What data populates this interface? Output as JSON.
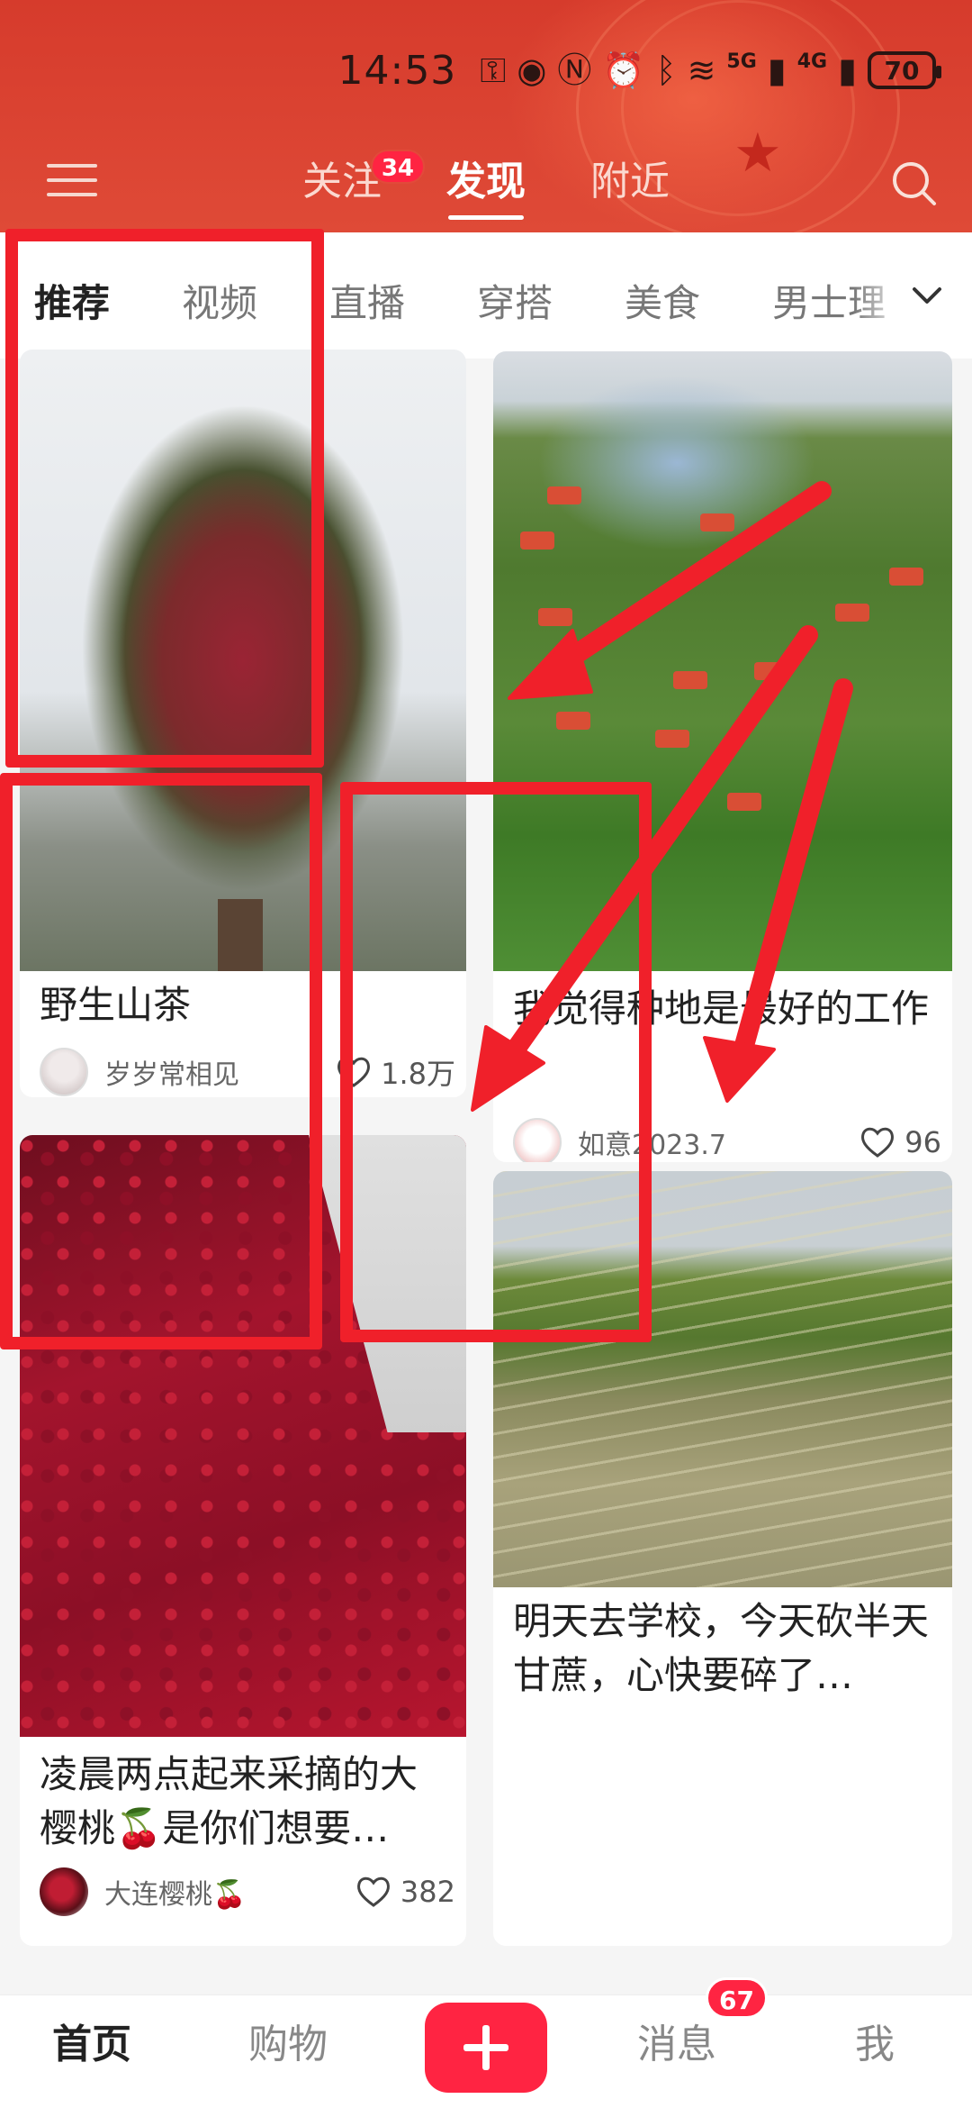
{
  "status_bar": {
    "time": "14:53",
    "net1": "5G",
    "net2": "4G",
    "battery": "70"
  },
  "top_tabs": [
    {
      "label": "关注",
      "badge": "34"
    },
    {
      "label": "发现",
      "active": true
    },
    {
      "label": "附近"
    }
  ],
  "categories": [
    "推荐",
    "视频",
    "直播",
    "穿搭",
    "美食",
    "男士理"
  ],
  "cards": [
    {
      "title": "野生山茶",
      "author": "岁岁常相见",
      "likes": "1.8万"
    },
    {
      "title": "我觉得种地是最好的工作",
      "author": "如意2023.7",
      "likes": "96"
    },
    {
      "title": "凌晨两点起来采摘的大樱桃🍒是你们想要…",
      "author": "大连樱桃🍒",
      "likes": "382"
    },
    {
      "title": "明天去学校，今天砍半天甘蔗，心快要碎了…"
    }
  ],
  "bottom_nav": {
    "home": "首页",
    "shop": "购物",
    "messages": "消息",
    "messages_badge": "67",
    "me": "我"
  },
  "colors": {
    "brand": "#ff2442",
    "header": "#d63b2c",
    "annotation": "#f0202a"
  }
}
